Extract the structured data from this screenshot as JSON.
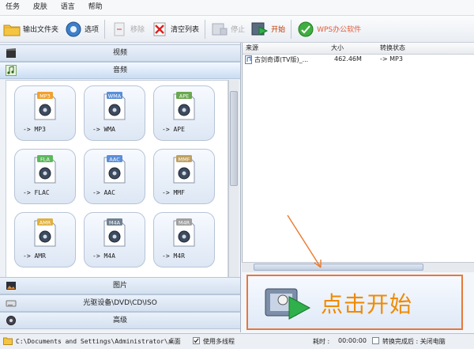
{
  "menu": [
    "任务",
    "皮肤",
    "语言",
    "帮助"
  ],
  "toolbar": {
    "output_folder": "输出文件夹",
    "options": "选项",
    "remove": "移除",
    "clear_list": "清空列表",
    "stop": "停止",
    "start": "开始",
    "wps": "WPS办公软件"
  },
  "left": {
    "cat_video": "视频",
    "cat_audio": "音频",
    "cat_image": "图片",
    "cat_rom": "光驱设备\\DVD\\CD\\ISO",
    "cat_advanced": "高级",
    "formats": [
      {
        "tag": "MP3",
        "label": "-> MP3"
      },
      {
        "tag": "WMA",
        "label": "-> WMA"
      },
      {
        "tag": "APE",
        "label": "-> APE"
      },
      {
        "tag": "FLA",
        "label": "-> FLAC"
      },
      {
        "tag": "AAC",
        "label": "-> AAC"
      },
      {
        "tag": "MMF",
        "label": "-> MMF"
      },
      {
        "tag": "AMR",
        "label": "-> AMR"
      },
      {
        "tag": "M4A",
        "label": "-> M4A"
      },
      {
        "tag": "M4R",
        "label": "-> M4R"
      }
    ]
  },
  "table": {
    "headers": [
      "来源",
      "大小",
      "转换状态"
    ],
    "rows": [
      {
        "source": "古剑奇谭(TV版)_...",
        "size": "462.46M",
        "status": "-> MP3"
      }
    ]
  },
  "start_panel": {
    "text": "点击开始"
  },
  "status": {
    "path": "C:\\Documents and Settings\\Administrator\\桌面",
    "multithread": "使用多线程",
    "elapsed_label": "耗时 :",
    "elapsed": "00:00:00",
    "after_convert": "转换完成后 : 关闭电脑"
  },
  "colors": {
    "accent": "#f08a00",
    "panel_border": "#e7783a"
  }
}
